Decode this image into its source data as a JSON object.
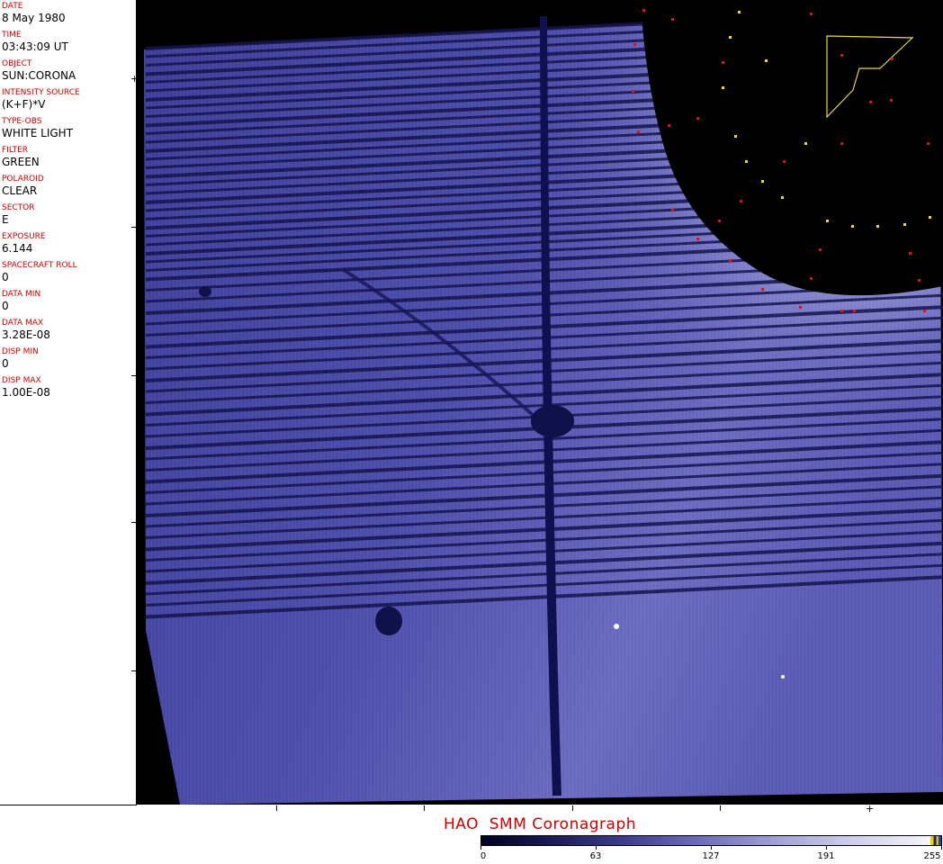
{
  "metadata": [
    {
      "label": "DATE",
      "value": "8 May 1980"
    },
    {
      "label": "TIME",
      "value": "03:43:09 UT"
    },
    {
      "label": "OBJECT",
      "value": "SUN:CORONA"
    },
    {
      "label": "INTENSITY SOURCE",
      "value": "(K+F)*V"
    },
    {
      "label": "TYPE-OBS",
      "value": "WHITE LIGHT"
    },
    {
      "label": "FILTER",
      "value": "GREEN"
    },
    {
      "label": "POLAROID",
      "value": "CLEAR"
    },
    {
      "label": "SECTOR",
      "value": "E"
    },
    {
      "label": "EXPOSURE",
      "value": "6.144"
    },
    {
      "label": "SPACECRAFT ROLL",
      "value": "0"
    },
    {
      "label": "DATA MIN",
      "value": "0"
    },
    {
      "label": "DATA MAX",
      "value": "3.28E-08"
    },
    {
      "label": "DISP MIN",
      "value": "0"
    },
    {
      "label": "DISP MAX",
      "value": "1.00E-08"
    }
  ],
  "footer": {
    "title": "HAO  SMM Coronagraph"
  },
  "colorbar": {
    "labels": [
      "0",
      "63",
      "127",
      "191",
      "255"
    ]
  },
  "colors": {
    "label": "#cc0000",
    "image_tint": "#4a4aa8",
    "background": "#000000"
  }
}
